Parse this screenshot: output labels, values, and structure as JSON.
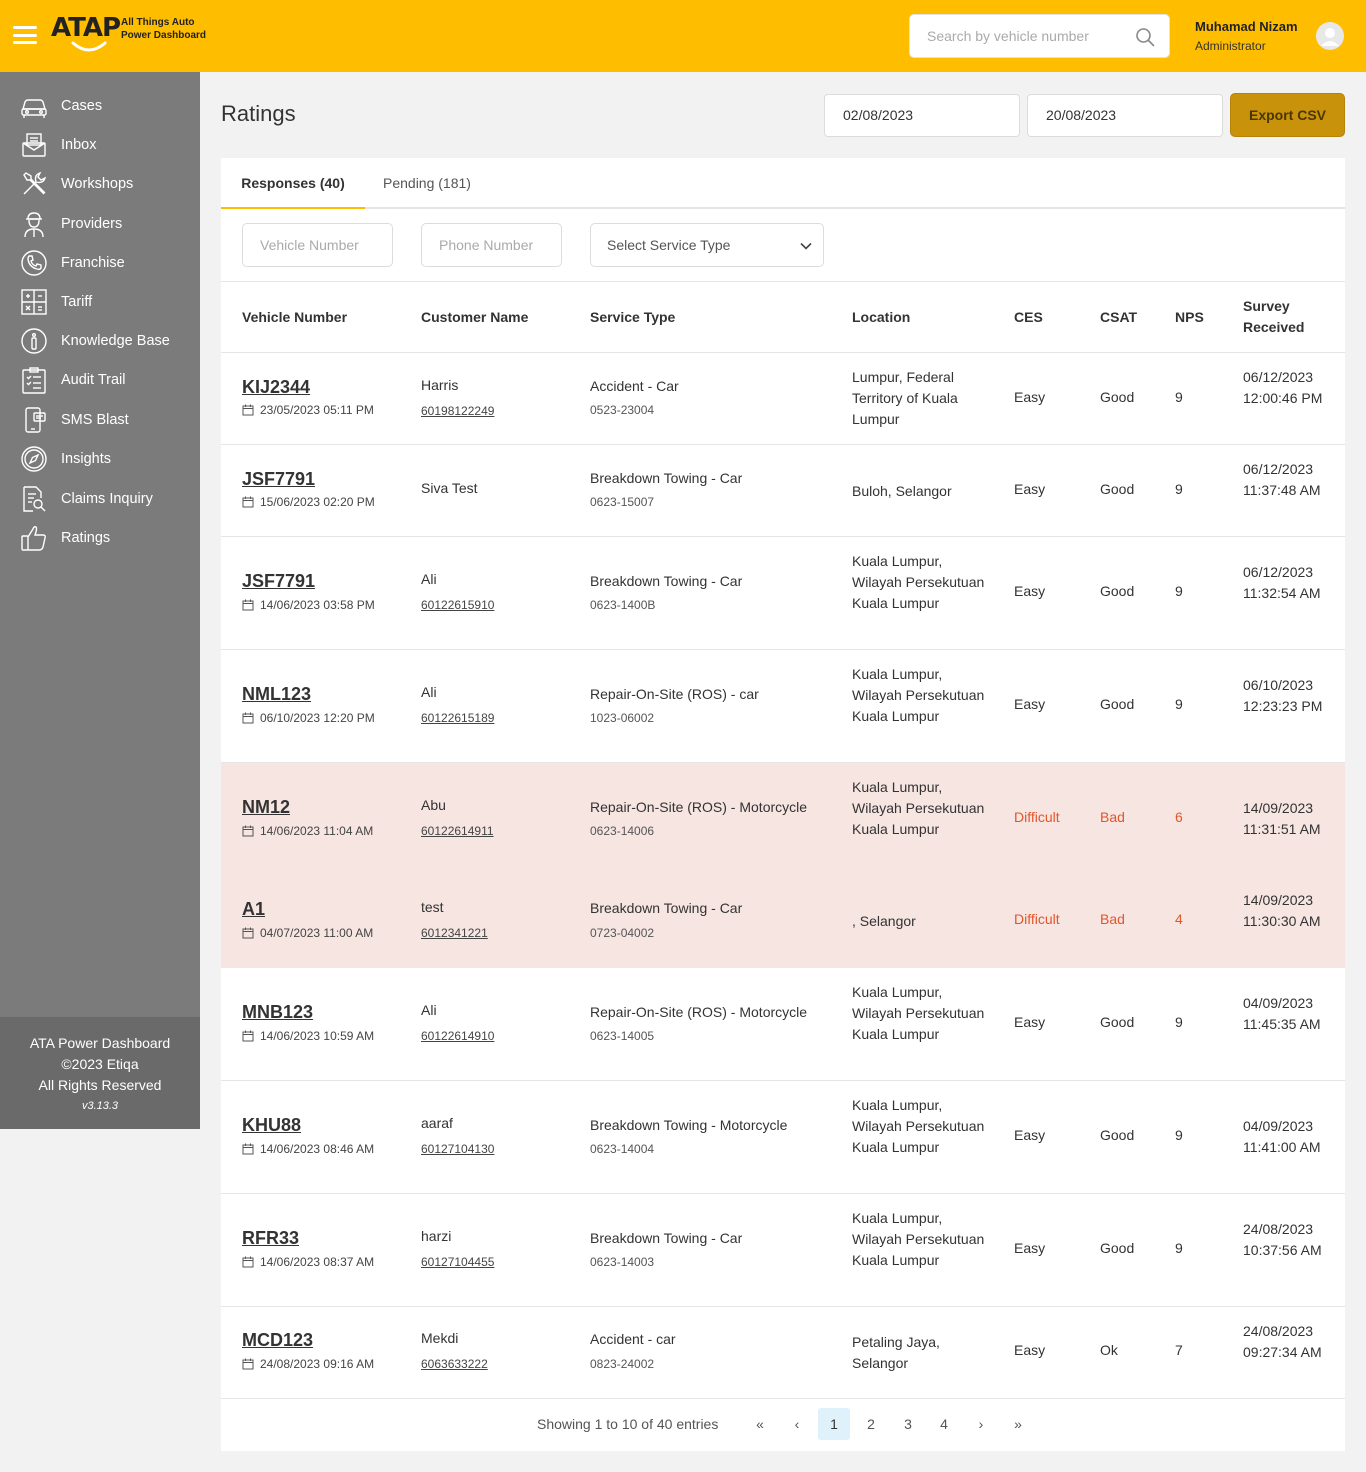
{
  "header": {
    "logo_text": "ATAP",
    "logo_sub_line1": "All Things Auto",
    "logo_sub_line2": "Power Dashboard",
    "search_placeholder": "Search by vehicle number",
    "user_name": "Muhamad Nizam",
    "user_role": "Administrator",
    "accent_color": "#ffbd00"
  },
  "sidebar": {
    "items": [
      {
        "label": "Cases",
        "icon": "car-icon"
      },
      {
        "label": "Inbox",
        "icon": "inbox-icon"
      },
      {
        "label": "Workshops",
        "icon": "tools-icon"
      },
      {
        "label": "Providers",
        "icon": "worker-icon"
      },
      {
        "label": "Franchise",
        "icon": "phone-icon"
      },
      {
        "label": "Tariff",
        "icon": "calculator-icon"
      },
      {
        "label": "Knowledge Base",
        "icon": "info-icon"
      },
      {
        "label": "Audit Trail",
        "icon": "clipboard-icon"
      },
      {
        "label": "SMS Blast",
        "icon": "mobile-icon"
      },
      {
        "label": "Insights",
        "icon": "compass-icon"
      },
      {
        "label": "Claims Inquiry",
        "icon": "document-search-icon"
      },
      {
        "label": "Ratings",
        "icon": "thumbs-up-icon"
      }
    ],
    "footer_line1": "ATA Power Dashboard",
    "footer_line2": "©2023 Etiqa",
    "footer_line3": "All Rights Reserved",
    "version": "v3.13.3"
  },
  "page": {
    "title": "Ratings",
    "date_from": "02/08/2023",
    "date_to": "20/08/2023",
    "export_label": "Export CSV"
  },
  "tabs": [
    {
      "label": "Responses (40)",
      "active": true
    },
    {
      "label": "Pending (181)",
      "active": false
    }
  ],
  "filters": {
    "vehicle_placeholder": "Vehicle Number",
    "phone_placeholder": "Phone Number",
    "service_type_label": "Select Service Type"
  },
  "table": {
    "columns": {
      "vehicle": "Vehicle Number",
      "customer": "Customer Name",
      "service": "Service Type",
      "location": "Location",
      "ces": "CES",
      "csat": "CSAT",
      "nps": "NPS",
      "survey1": "Survey",
      "survey2": "Received"
    },
    "rows": [
      {
        "vehicle": "KIJ2344",
        "date": "23/05/2023 05:11 PM",
        "customer": "Harris",
        "phone": "60198122249",
        "service": "Accident - Car",
        "service_id": "0523-23004",
        "location": "Lumpur, Federal Territory of Kuala Lumpur",
        "ces": "Easy",
        "csat": "Good",
        "nps": "9",
        "survey": "06/12/2023 12:00:46 PM"
      },
      {
        "vehicle": "JSF7791",
        "date": "15/06/2023 02:20 PM",
        "customer": "Siva Test",
        "phone": "",
        "service": "Breakdown Towing - Car",
        "service_id": "0623-15007",
        "location": "Buloh, Selangor",
        "ces": "Easy",
        "csat": "Good",
        "nps": "9",
        "survey": "06/12/2023 11:37:48 AM"
      },
      {
        "vehicle": "JSF7791",
        "date": "14/06/2023 03:58 PM",
        "customer": "Ali",
        "phone": "60122615910",
        "service": "Breakdown Towing - Car",
        "service_id": "0623-1400B",
        "location": "Kuala Lumpur, Wilayah Persekutuan Kuala Lumpur",
        "ces": "Easy",
        "csat": "Good",
        "nps": "9",
        "survey": "06/12/2023 11:32:54 AM"
      },
      {
        "vehicle": "NML123",
        "date": "06/10/2023 12:20 PM",
        "customer": "Ali",
        "phone": "60122615189",
        "service": "Repair-On-Site (ROS) - car",
        "service_id": "1023-06002",
        "location": "Kuala Lumpur, Wilayah Persekutuan Kuala Lumpur",
        "ces": "Easy",
        "csat": "Good",
        "nps": "9",
        "survey": "06/10/2023 12:23:23 PM"
      },
      {
        "vehicle": "NM12",
        "date": "14/06/2023 11:04 AM",
        "customer": "Abu",
        "phone": "60122614911",
        "service": "Repair-On-Site (ROS) - Motorcycle",
        "service_id": "0623-14006",
        "location": "Kuala Lumpur, Wilayah Persekutuan Kuala Lumpur",
        "ces": "Difficult",
        "csat": "Bad",
        "nps": "6",
        "survey": "14/09/2023 11:31:51 AM"
      },
      {
        "vehicle": "A1",
        "date": "04/07/2023 11:00 AM",
        "customer": "test",
        "phone": "6012341221",
        "service": "Breakdown Towing - Car",
        "service_id": "0723-04002",
        "location": ", Selangor",
        "ces": "Difficult",
        "csat": "Bad",
        "nps": "4",
        "survey": "14/09/2023 11:30:30 AM"
      },
      {
        "vehicle": "MNB123",
        "date": "14/06/2023 10:59 AM",
        "customer": "Ali",
        "phone": "60122614910",
        "service": "Repair-On-Site (ROS) - Motorcycle",
        "service_id": "0623-14005",
        "location": "Kuala Lumpur, Wilayah Persekutuan Kuala Lumpur",
        "ces": "Easy",
        "csat": "Good",
        "nps": "9",
        "survey": "04/09/2023 11:45:35 AM"
      },
      {
        "vehicle": "KHU88",
        "date": "14/06/2023 08:46 AM",
        "customer": "aaraf",
        "phone": "60127104130",
        "service": "Breakdown Towing - Motorcycle",
        "service_id": "0623-14004",
        "location": "Kuala Lumpur, Wilayah Persekutuan Kuala Lumpur",
        "ces": "Easy",
        "csat": "Good",
        "nps": "9",
        "survey": "04/09/2023 11:41:00 AM"
      },
      {
        "vehicle": "RFR33",
        "date": "14/06/2023 08:37 AM",
        "customer": "harzi",
        "phone": "60127104455",
        "service": "Breakdown Towing - Car",
        "service_id": "0623-14003",
        "location": "Kuala Lumpur, Wilayah Persekutuan Kuala Lumpur",
        "ces": "Easy",
        "csat": "Good",
        "nps": "9",
        "survey": "24/08/2023 10:37:56 AM"
      },
      {
        "vehicle": "MCD123",
        "date": "24/08/2023 09:16 AM",
        "customer": "Mekdi",
        "phone": "6063633222",
        "service": "Accident - car",
        "service_id": "0823-24002",
        "location": "Petaling Jaya, Selangor",
        "ces": "Easy",
        "csat": "Ok",
        "nps": "7",
        "survey": "24/08/2023 09:27:34 AM"
      }
    ]
  },
  "pagination": {
    "info": "Showing 1 to 10 of 40 entries",
    "first": "«",
    "prev": "‹",
    "pages": [
      "1",
      "2",
      "3",
      "4"
    ],
    "current": "1",
    "next": "›",
    "last": "»"
  },
  "colors": {
    "bad_row_bg": "#f6e5e1",
    "negative_text": "#e2562b",
    "sidebar_bg": "#7b7b7b",
    "export_button": "#c8930a"
  }
}
